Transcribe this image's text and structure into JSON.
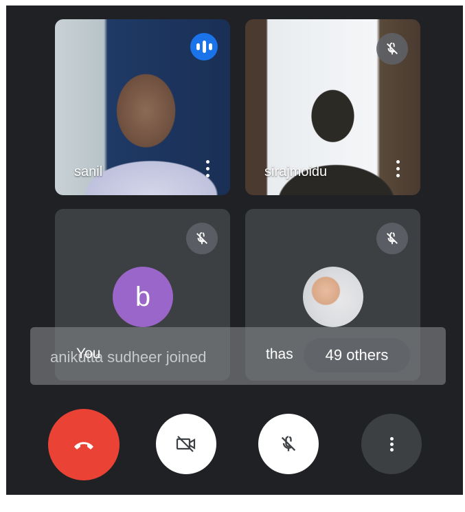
{
  "participants": [
    {
      "name": "sanil",
      "status": "speaking"
    },
    {
      "name": "sirajmoidu",
      "status": "muted"
    },
    {
      "avatar_letter": "b",
      "status": "muted"
    },
    {
      "name": "thas",
      "status": "muted"
    }
  ],
  "toast": {
    "join_text": "anikutta sudheer joined",
    "self_label": "You",
    "others": "49 others"
  },
  "controls": [
    "end-call",
    "camera-off",
    "mic-off",
    "more-options"
  ],
  "colors": {
    "background": "#202124",
    "end_call": "#ea4335",
    "speaking": "#1a73e8",
    "avatar_b": "#9a66c9"
  }
}
